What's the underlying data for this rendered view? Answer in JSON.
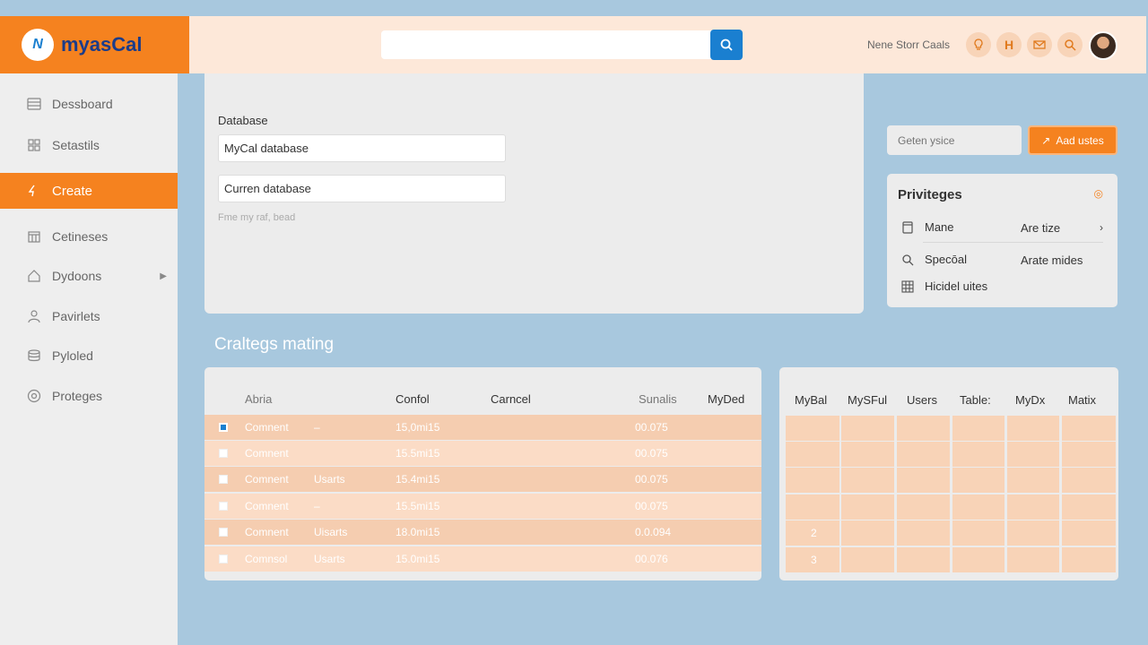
{
  "brand": {
    "name": "myasCal"
  },
  "header": {
    "search_placeholder": "",
    "user_text": "Nene Storr Caals",
    "icons": [
      "bulb-icon",
      "h-icon",
      "mail-icon",
      "search-icon"
    ],
    "letter_icon": "H"
  },
  "sidebar": {
    "items": [
      {
        "label": "Dessboard",
        "icon": "dashboard-icon"
      },
      {
        "label": "Setastils",
        "icon": "settings-icon"
      },
      {
        "label": "Create",
        "icon": "create-icon",
        "active": true
      },
      {
        "label": "Cetineses",
        "icon": "calendar-icon"
      },
      {
        "label": "Dydoons",
        "icon": "home-icon",
        "has_submenu": true
      },
      {
        "label": "Pavirlets",
        "icon": "user-icon"
      },
      {
        "label": "Pyloled",
        "icon": "layers-icon"
      },
      {
        "label": "Proteges",
        "icon": "shield-icon"
      }
    ]
  },
  "form": {
    "label": "Database",
    "field1_value": "MyCal database",
    "field2_value": "Curren database",
    "hint": "Fme my raf, bead"
  },
  "right": {
    "getin_placeholder": "Geten ysice",
    "add_button": "Aad ustes",
    "privileges": {
      "title": "Priviteges",
      "rows": [
        {
          "icon": "file-icon",
          "label": "Mane",
          "right": "Are tize"
        },
        {
          "icon": "search-icon",
          "label": "Specōal",
          "right": "Arate mides"
        },
        {
          "icon": "grid-icon",
          "label": "Hicidel uites",
          "right": ""
        }
      ]
    }
  },
  "section_title": "Craltegs mating",
  "table": {
    "headers": [
      "Abria",
      "Confol",
      "Carncel",
      "Sunalis",
      "MyDed"
    ],
    "rows": [
      {
        "checked": true,
        "c1": "Comnent",
        "c2": "–",
        "c3": "15,0mi15",
        "c4": "00.075"
      },
      {
        "checked": false,
        "c1": "Comnent",
        "c2": "",
        "c3": "15.5mi15",
        "c4": "00.075"
      },
      {
        "checked": false,
        "c1": "Comnent",
        "c2": "Usarts",
        "c3": "15.4mi15",
        "c4": "00.075"
      },
      {
        "checked": false,
        "c1": "Comnent",
        "c2": "–",
        "c3": "15.5mi15",
        "c4": "00.075"
      },
      {
        "checked": false,
        "c1": "Comnent",
        "c2": "Uisarts",
        "c3": "18.0mi15",
        "c4": "0.0.094"
      },
      {
        "checked": false,
        "c1": "Comnsol",
        "c2": "Usarts",
        "c3": "15.0mi15",
        "c4": "00.076"
      }
    ]
  },
  "grid": {
    "headers": [
      "MyBal",
      "MySFul",
      "Users",
      "Table:",
      "MyDx",
      "Matix"
    ],
    "row_labels": [
      "",
      "",
      "",
      "",
      "2",
      "3"
    ]
  },
  "colors": {
    "accent": "#f5821f",
    "primary": "#1a7fd0",
    "background": "#a8c8de"
  }
}
